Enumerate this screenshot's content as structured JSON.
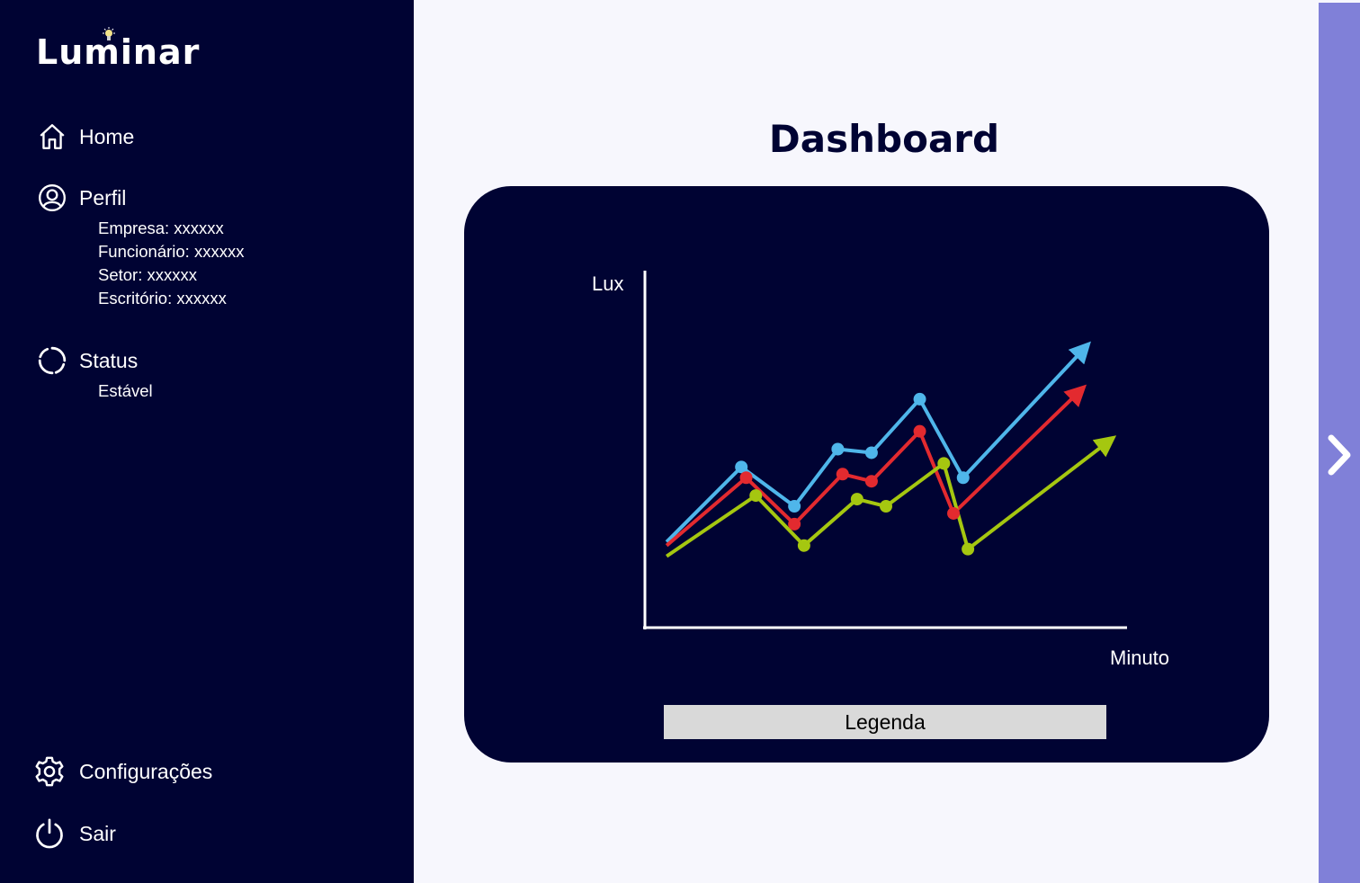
{
  "app": {
    "name": "Luminar"
  },
  "sidebar": {
    "home_label": "Home",
    "profile_label": "Perfil",
    "profile_details": [
      "Empresa: xxxxxx",
      "Funcionário: xxxxxx",
      "Setor: xxxxxx",
      "Escritório: xxxxxx"
    ],
    "status_label": "Status",
    "status_value": "Estável",
    "settings_label": "Configurações",
    "logout_label": "Sair"
  },
  "main": {
    "title": "Dashboard",
    "legend_button": "Legenda"
  },
  "icons": {
    "home": "home-icon",
    "profile": "user-circle-icon",
    "status": "loading-circle-icon",
    "settings": "gear-icon",
    "logout": "power-icon",
    "next": "chevron-right-icon",
    "bulb": "lightbulb-icon"
  },
  "colors": {
    "sidebar_bg": "#000333",
    "page_bg": "#f7f7fd",
    "card_bg": "#000333",
    "right_panel": "#8080d8",
    "legend_bg": "#d9d9d9"
  },
  "chart_data": {
    "type": "line",
    "xlabel": "Minuto",
    "ylabel": "Lux",
    "xlim": [
      0,
      10
    ],
    "ylim": [
      0,
      10
    ],
    "grid": false,
    "axis_ticks": false,
    "series": [
      {
        "color": "#4fb6ea",
        "points": [
          [
            0.45,
            2.4
          ],
          [
            2.0,
            4.5
          ],
          [
            3.1,
            3.4
          ],
          [
            4.0,
            5.0
          ],
          [
            4.7,
            4.9
          ],
          [
            5.7,
            6.4
          ],
          [
            6.6,
            4.2
          ],
          [
            9.1,
            7.8
          ]
        ],
        "markers": [
          1,
          2,
          3,
          4,
          5,
          6
        ]
      },
      {
        "color": "#e32a2f",
        "points": [
          [
            0.45,
            2.3
          ],
          [
            2.1,
            4.2
          ],
          [
            3.1,
            2.9
          ],
          [
            4.1,
            4.3
          ],
          [
            4.7,
            4.1
          ],
          [
            5.7,
            5.5
          ],
          [
            6.4,
            3.2
          ],
          [
            9.0,
            6.6
          ]
        ],
        "markers": [
          1,
          2,
          3,
          4,
          5,
          6
        ]
      },
      {
        "color": "#a5c710",
        "points": [
          [
            0.45,
            2.0
          ],
          [
            2.3,
            3.7
          ],
          [
            3.3,
            2.3
          ],
          [
            4.4,
            3.6
          ],
          [
            5.0,
            3.4
          ],
          [
            6.2,
            4.6
          ],
          [
            6.7,
            2.2
          ],
          [
            9.6,
            5.2
          ]
        ],
        "markers": [
          1,
          2,
          3,
          4,
          5,
          6
        ]
      }
    ]
  }
}
